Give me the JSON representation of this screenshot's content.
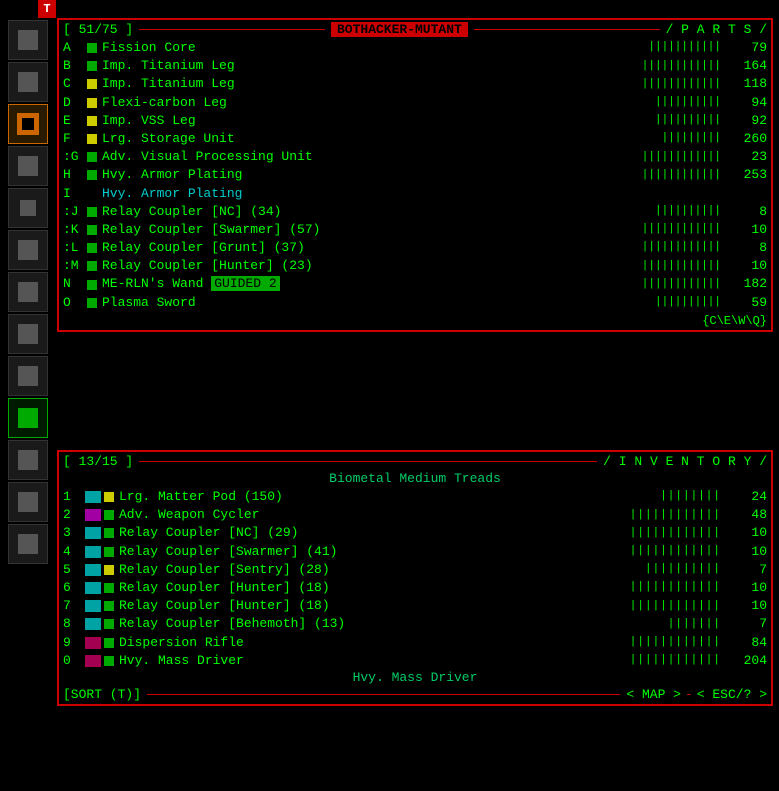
{
  "topBar": {
    "icon": "T"
  },
  "sidebar": {
    "items": [
      {
        "color": "gray"
      },
      {
        "color": "gray"
      },
      {
        "color": "orange-x"
      },
      {
        "color": "gray"
      },
      {
        "color": "gray-small"
      },
      {
        "color": "gray"
      },
      {
        "color": "gray"
      },
      {
        "color": "gray"
      },
      {
        "color": "gray"
      },
      {
        "color": "green"
      },
      {
        "color": "gray"
      },
      {
        "color": "gray"
      },
      {
        "color": "gray"
      }
    ]
  },
  "partsPanel": {
    "header_open": "[ 51/75 ]",
    "title": "BOTHACKER-MUTANT",
    "header_right": "/ P A R T S /",
    "footer": "{C\\E\\W\\Q}",
    "items": [
      {
        "key": "A",
        "color": "#00aa00",
        "name": "Fission Core",
        "bars": "|||||||||||",
        "value": "79"
      },
      {
        "key": "B",
        "color": "#00aa00",
        "name": "Imp. Titanium Leg",
        "bars": "||||||||||||",
        "value": "164"
      },
      {
        "key": "C",
        "color": "#cccc00",
        "name": "Imp. Titanium Leg",
        "bars": "||||||||||||",
        "value": "118"
      },
      {
        "key": "D",
        "color": "#cccc00",
        "name": "Flexi-carbon Leg",
        "bars": "||||||||||",
        "value": "94"
      },
      {
        "key": "E",
        "color": "#cccc00",
        "name": "Imp. VSS Leg",
        "bars": "||||||||||",
        "value": "92"
      },
      {
        "key": "F",
        "color": "#cccc00",
        "name": "Lrg. Storage Unit",
        "bars": "|||||||||",
        "value": "260"
      },
      {
        "key": ":G",
        "color": "#00aa00",
        "name": "Adv. Visual Processing Unit",
        "bars": "||||||||||||",
        "value": "23"
      },
      {
        "key": "H",
        "color": "#00aa00",
        "name": "Hvy. Armor Plating",
        "bars": "||||||||||||",
        "value": "253"
      },
      {
        "key": "I",
        "color": null,
        "name": "Hvy. Armor Plating",
        "bars": "",
        "value": "",
        "style": "cyan"
      },
      {
        "key": ":J",
        "color": "#00aa00",
        "name": "Relay Coupler [NC] (34)",
        "bars": "||||||||||",
        "value": "8"
      },
      {
        "key": ":K",
        "color": "#00aa00",
        "name": "Relay Coupler [Swarmer] (57)",
        "bars": "||||||||||||",
        "value": "10"
      },
      {
        "key": ":L",
        "color": "#00aa00",
        "name": "Relay Coupler [Grunt] (37)",
        "bars": "||||||||||||",
        "value": "8"
      },
      {
        "key": ":M",
        "color": "#00aa00",
        "name": "Relay Coupler [Hunter] (23)",
        "bars": "||||||||||||",
        "value": "10"
      },
      {
        "key": "N",
        "color": "#00aa00",
        "name": "ME-RLN's Wand",
        "highlight": "GUIDED 2",
        "bars": "||||||||||||",
        "value": "182"
      },
      {
        "key": "O",
        "color": "#00aa00",
        "name": "Plasma Sword",
        "bars": "||||||||||",
        "value": "59"
      }
    ]
  },
  "inventoryPanel": {
    "header_open": "[ 13/15 ]",
    "header_right": "/ I N V E N T O R Y /",
    "subtitle": "Biometal Medium Treads",
    "subtitle2": "Hvy. Mass Driver",
    "items": [
      {
        "key": "1",
        "icon_color": "#00cccc",
        "color": "#cccc00",
        "name": "Lrg. Matter Pod (150)",
        "bars": "||||||||",
        "value": "24"
      },
      {
        "key": "2",
        "icon_color": "#cc00cc",
        "color": "#00aa00",
        "name": "Adv. Weapon Cycler",
        "bars": "||||||||||||",
        "value": "48"
      },
      {
        "key": "3",
        "icon_color": "#00cccc",
        "color": "#00aa00",
        "name": "Relay Coupler [NC] (29)",
        "bars": "||||||||||||",
        "value": "10"
      },
      {
        "key": "4",
        "icon_color": "#00cccc",
        "color": "#00aa00",
        "name": "Relay Coupler [Swarmer] (41)",
        "bars": "||||||||||||",
        "value": "10"
      },
      {
        "key": "5",
        "icon_color": "#00cccc",
        "color": "#cccc00",
        "name": "Relay Coupler [Sentry] (28)",
        "bars": "||||||||||",
        "value": "7"
      },
      {
        "key": "6",
        "icon_color": "#00cccc",
        "color": "#00aa00",
        "name": "Relay Coupler [Hunter] (18)",
        "bars": "||||||||||||",
        "value": "10"
      },
      {
        "key": "7",
        "icon_color": "#00cccc",
        "color": "#00aa00",
        "name": "Relay Coupler [Hunter] (18)",
        "bars": "||||||||||||",
        "value": "10"
      },
      {
        "key": "8",
        "icon_color": "#00cccc",
        "color": "#00aa00",
        "name": "Relay Coupler [Behemoth] (13)",
        "bars": "|||||||",
        "value": "7"
      },
      {
        "key": "9",
        "icon_color": "#cc0066",
        "color": "#00aa00",
        "name": "Dispersion Rifle",
        "bars": "||||||||||||",
        "value": "84"
      },
      {
        "key": "0",
        "icon_color": "#cc0066",
        "color": "#00aa00",
        "name": "Hvy. Mass Driver",
        "bars": "||||||||||||",
        "value": "204"
      }
    ],
    "footer_left": "[SORT (T)]",
    "footer_mid": "< MAP >",
    "footer_right": "< ESC/? >"
  }
}
